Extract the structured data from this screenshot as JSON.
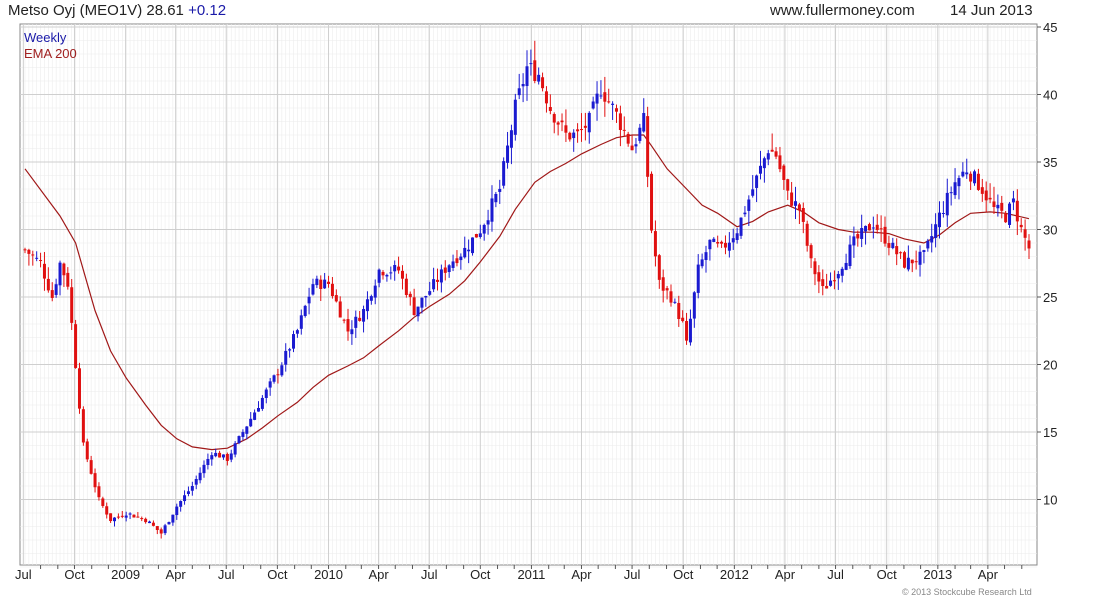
{
  "header": {
    "name": "Metso Oyj (MEO1V)",
    "price": "28.61",
    "change": "+0.12",
    "source": "www.fullermoney.com",
    "date": "14 Jun 2013"
  },
  "legend": {
    "period": "Weekly",
    "indicator": "EMA 200"
  },
  "copyright": "© 2013 Stockcube Research Ltd",
  "colors": {
    "up": "#1a1ad0",
    "down": "#e01010",
    "ema": "#a01818",
    "grid": "#cfcfcf",
    "minor_grid": "#ececec"
  },
  "chart_data": {
    "type": "candlestick",
    "period": "weekly",
    "x_start": "2008-07-04",
    "x_end": "2013-06-14",
    "ylim": [
      5,
      45
    ],
    "y_ticks": [
      10,
      15,
      20,
      25,
      30,
      35,
      40,
      45
    ],
    "x_ticks": [
      "Jul",
      "Oct",
      "2009",
      "Apr",
      "Jul",
      "Oct",
      "2010",
      "Apr",
      "Jul",
      "Oct",
      "2011",
      "Apr",
      "Jul",
      "Oct",
      "2012",
      "Apr",
      "Jul",
      "Oct",
      "2013",
      "Apr"
    ],
    "price_path": [
      [
        "2008-07-04",
        28.5
      ],
      [
        "2008-08-01",
        27.5
      ],
      [
        "2008-08-22",
        25
      ],
      [
        "2008-09-05",
        27.5
      ],
      [
        "2008-09-19",
        26
      ],
      [
        "2008-10-03",
        20
      ],
      [
        "2008-10-17",
        14
      ],
      [
        "2008-10-31",
        12
      ],
      [
        "2008-11-14",
        10
      ],
      [
        "2008-12-05",
        8.5
      ],
      [
        "2009-01-02",
        9
      ],
      [
        "2009-02-06",
        8.5
      ],
      [
        "2009-03-06",
        7.5
      ],
      [
        "2009-04-03",
        9.5
      ],
      [
        "2009-05-01",
        11
      ],
      [
        "2009-06-05",
        13.5
      ],
      [
        "2009-07-03",
        13
      ],
      [
        "2009-08-07",
        15.5
      ],
      [
        "2009-09-04",
        17.5
      ],
      [
        "2009-10-02",
        19.5
      ],
      [
        "2009-11-06",
        22.5
      ],
      [
        "2009-12-04",
        26
      ],
      [
        "2010-01-01",
        26
      ],
      [
        "2010-02-05",
        22.5
      ],
      [
        "2010-03-05",
        24
      ],
      [
        "2010-04-02",
        27
      ],
      [
        "2010-05-07",
        27
      ],
      [
        "2010-06-04",
        24
      ],
      [
        "2010-07-02",
        25.5
      ],
      [
        "2010-08-06",
        27.5
      ],
      [
        "2010-09-03",
        28.5
      ],
      [
        "2010-10-01",
        30
      ],
      [
        "2010-11-05",
        33
      ],
      [
        "2010-12-03",
        39
      ],
      [
        "2010-12-24",
        42
      ],
      [
        "2011-01-14",
        41.5
      ],
      [
        "2011-02-04",
        39
      ],
      [
        "2011-03-04",
        37
      ],
      [
        "2011-03-25",
        37
      ],
      [
        "2011-04-15",
        38
      ],
      [
        "2011-05-06",
        40.5
      ],
      [
        "2011-06-03",
        38.5
      ],
      [
        "2011-07-01",
        36
      ],
      [
        "2011-07-22",
        38
      ],
      [
        "2011-08-05",
        30
      ],
      [
        "2011-08-19",
        26
      ],
      [
        "2011-09-09",
        25
      ],
      [
        "2011-09-30",
        23
      ],
      [
        "2011-10-07",
        21.5
      ],
      [
        "2011-10-28",
        27
      ],
      [
        "2011-11-18",
        29
      ],
      [
        "2011-12-09",
        28.5
      ],
      [
        "2012-01-06",
        30
      ],
      [
        "2012-02-03",
        33
      ],
      [
        "2012-03-02",
        36
      ],
      [
        "2012-03-16",
        35.5
      ],
      [
        "2012-04-06",
        32.5
      ],
      [
        "2012-04-27",
        31.5
      ],
      [
        "2012-05-18",
        27.5
      ],
      [
        "2012-06-08",
        25.5
      ],
      [
        "2012-07-06",
        27
      ],
      [
        "2012-08-03",
        29
      ],
      [
        "2012-09-07",
        30.5
      ],
      [
        "2012-10-05",
        29
      ],
      [
        "2012-11-02",
        27.5
      ],
      [
        "2012-12-07",
        28
      ],
      [
        "2013-01-04",
        31
      ],
      [
        "2013-02-01",
        33.5
      ],
      [
        "2013-02-22",
        34.5
      ],
      [
        "2013-03-22",
        33
      ],
      [
        "2013-04-12",
        31.5
      ],
      [
        "2013-05-03",
        31
      ],
      [
        "2013-05-17",
        32
      ],
      [
        "2013-05-31",
        30
      ],
      [
        "2013-06-14",
        28.61
      ]
    ],
    "ema_200": [
      [
        "2008-07-04",
        34.5
      ],
      [
        "2008-09-05",
        31
      ],
      [
        "2008-10-03",
        29
      ],
      [
        "2008-11-07",
        24
      ],
      [
        "2008-12-05",
        21
      ],
      [
        "2009-01-02",
        19
      ],
      [
        "2009-02-06",
        17
      ],
      [
        "2009-03-06",
        15.5
      ],
      [
        "2009-04-03",
        14.5
      ],
      [
        "2009-05-01",
        13.9
      ],
      [
        "2009-06-05",
        13.7
      ],
      [
        "2009-07-03",
        13.8
      ],
      [
        "2009-08-07",
        14.5
      ],
      [
        "2009-09-04",
        15.3
      ],
      [
        "2009-10-02",
        16.2
      ],
      [
        "2009-11-06",
        17.2
      ],
      [
        "2009-12-04",
        18.3
      ],
      [
        "2010-01-01",
        19.2
      ],
      [
        "2010-02-05",
        19.9
      ],
      [
        "2010-03-05",
        20.5
      ],
      [
        "2010-04-02",
        21.4
      ],
      [
        "2010-05-07",
        22.5
      ],
      [
        "2010-06-04",
        23.5
      ],
      [
        "2010-07-02",
        24.3
      ],
      [
        "2010-08-06",
        25.2
      ],
      [
        "2010-09-03",
        26.2
      ],
      [
        "2010-10-01",
        27.6
      ],
      [
        "2010-11-05",
        29.5
      ],
      [
        "2010-12-03",
        31.5
      ],
      [
        "2011-01-07",
        33.5
      ],
      [
        "2011-02-04",
        34.3
      ],
      [
        "2011-03-04",
        34.9
      ],
      [
        "2011-04-01",
        35.6
      ],
      [
        "2011-05-06",
        36.3
      ],
      [
        "2011-06-03",
        36.8
      ],
      [
        "2011-07-01",
        37
      ],
      [
        "2011-07-22",
        37
      ],
      [
        "2011-08-05",
        36.2
      ],
      [
        "2011-09-02",
        34.5
      ],
      [
        "2011-10-07",
        33
      ],
      [
        "2011-11-04",
        31.8
      ],
      [
        "2011-12-02",
        31.2
      ],
      [
        "2012-01-06",
        30.2
      ],
      [
        "2012-02-03",
        30.6
      ],
      [
        "2012-03-02",
        31.3
      ],
      [
        "2012-04-06",
        31.8
      ],
      [
        "2012-05-04",
        31.3
      ],
      [
        "2012-06-01",
        30.5
      ],
      [
        "2012-07-06",
        30
      ],
      [
        "2012-08-03",
        29.8
      ],
      [
        "2012-09-07",
        29.8
      ],
      [
        "2012-10-05",
        29.7
      ],
      [
        "2012-11-02",
        29.3
      ],
      [
        "2012-12-07",
        29
      ],
      [
        "2013-01-04",
        29.6
      ],
      [
        "2013-02-01",
        30.5
      ],
      [
        "2013-03-01",
        31.2
      ],
      [
        "2013-04-05",
        31.3
      ],
      [
        "2013-05-03",
        31.2
      ],
      [
        "2013-06-14",
        30.8
      ]
    ]
  }
}
